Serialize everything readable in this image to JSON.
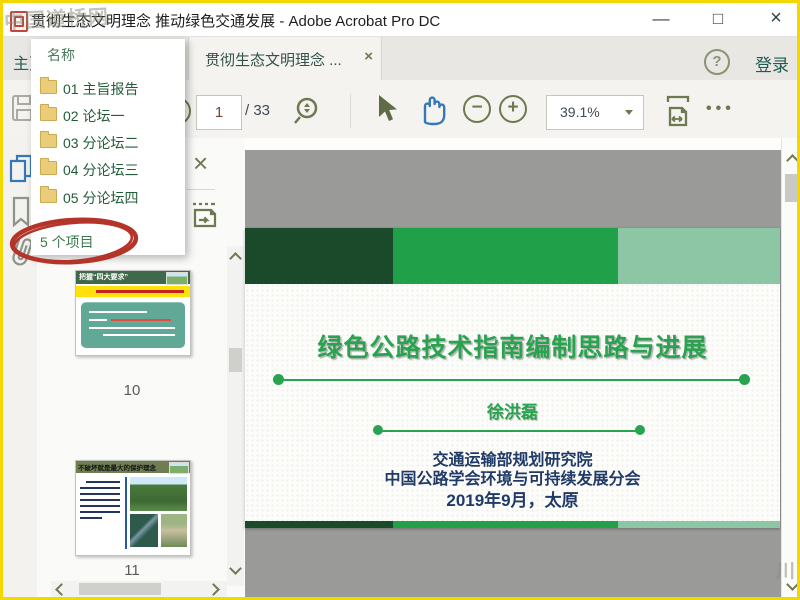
{
  "window": {
    "title": "贯彻生态文明理念 推动绿色交通发展 - Adobe Acrobat Pro DC",
    "minimize": "—",
    "maximize": "□",
    "close": "×"
  },
  "watermarks": {
    "top_left": "中国道桥网",
    "bottom_right": "川"
  },
  "tab_bar": {
    "home_tab": "主页",
    "document_tab": "贯彻生态文明理念 ...",
    "tab_close": "×",
    "help": "?",
    "sign_in": "登录"
  },
  "toolbar": {
    "page_value": "1",
    "page_total": "/ 33",
    "zoom_value": "39.1%",
    "more": "•••"
  },
  "nav_popup": {
    "header": "名称",
    "items": [
      {
        "label": "01 主旨报告"
      },
      {
        "label": "02 论坛一"
      },
      {
        "label": "03 分论坛二"
      },
      {
        "label": "04 分论坛三"
      },
      {
        "label": "05 分论坛四"
      }
    ],
    "footer": "5 个项目"
  },
  "thumbnails_panel": {
    "pages": [
      {
        "number": "10",
        "header": "把握“四大要求”"
      },
      {
        "number": "11",
        "header": "不破坏就是最大的保护理念"
      }
    ]
  },
  "slide": {
    "title": "绿色公路技术指南编制思路与进展",
    "author": "徐洪磊",
    "org_line1": "交通运输部规划研究院",
    "org_line2": "中国公路学会环境与可持续发展分会",
    "date_line": "2019年9月，太原"
  },
  "colors": {
    "accent_green": "#21a04a",
    "dark_green": "#1b4a2b",
    "light_green": "#8dc6a4",
    "title_green": "#2aa350",
    "navy": "#203a68",
    "annotation_red": "#b5342a",
    "selection_blue": "#3677b8",
    "icon_olive": "#6d7950",
    "border_yellow": "#f2d800"
  }
}
